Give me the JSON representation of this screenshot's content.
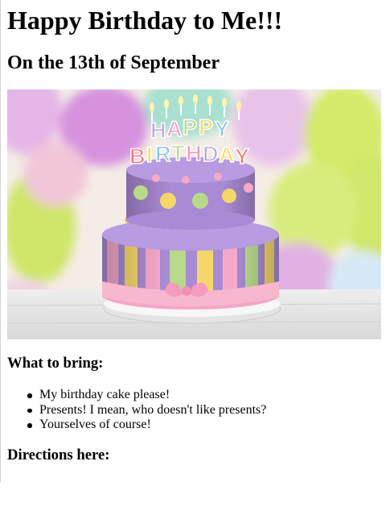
{
  "page": {
    "title": "Happy Birthday to Me!!!",
    "subtitle": "On the 13th of September"
  },
  "hero_image": {
    "cake_topper_text": "HAPPY BIRTHDAY",
    "colors": {
      "frosting_purple": "#a98ad4",
      "stripe_yellow": "#f3d76b",
      "stripe_pink": "#f6a9c7",
      "stripe_green": "#b8d98a",
      "ribbon": "#f7b7cf"
    }
  },
  "bring": {
    "heading": "What to bring:",
    "items": [
      "My birthday cake please!",
      "Presents! I mean, who doesn't like presents?",
      "Yourselves of course!"
    ]
  },
  "directions": {
    "heading": "Directions here:"
  }
}
